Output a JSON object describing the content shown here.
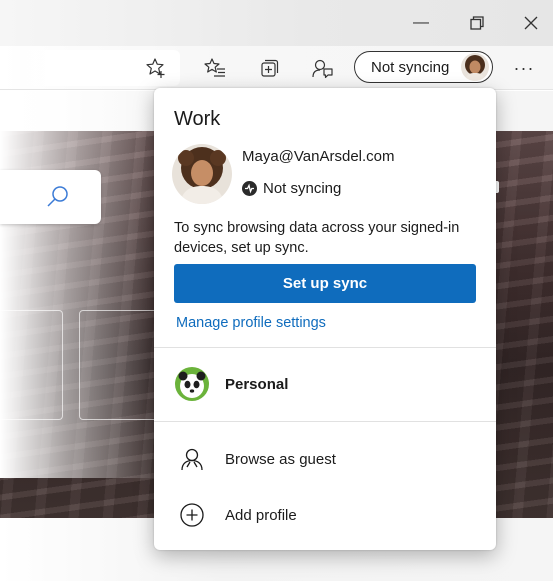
{
  "window": {
    "minimize_glyph": "—",
    "more_glyph": "···"
  },
  "toolbar": {
    "sync_status_label": "Not syncing",
    "icons": [
      "star-add-icon",
      "favorites-icon",
      "collections-icon",
      "feedback-icon",
      "more-icon"
    ]
  },
  "flyout": {
    "profile_title": "Work",
    "email": "Maya@VanArsdel.com",
    "sync_status": "Not syncing",
    "description": "To sync browsing data across your signed-in devices, set up sync.",
    "setup_sync_label": "Set up sync",
    "manage_link": "Manage profile settings",
    "other_profiles": [
      {
        "label": "Personal"
      }
    ],
    "actions": [
      {
        "label": "Browse as guest",
        "icon": "guest-icon"
      },
      {
        "label": "Add profile",
        "icon": "add-circle-icon"
      }
    ]
  },
  "colors": {
    "accent": "#0f6cbd",
    "panda_ring": "#6bb33b"
  }
}
